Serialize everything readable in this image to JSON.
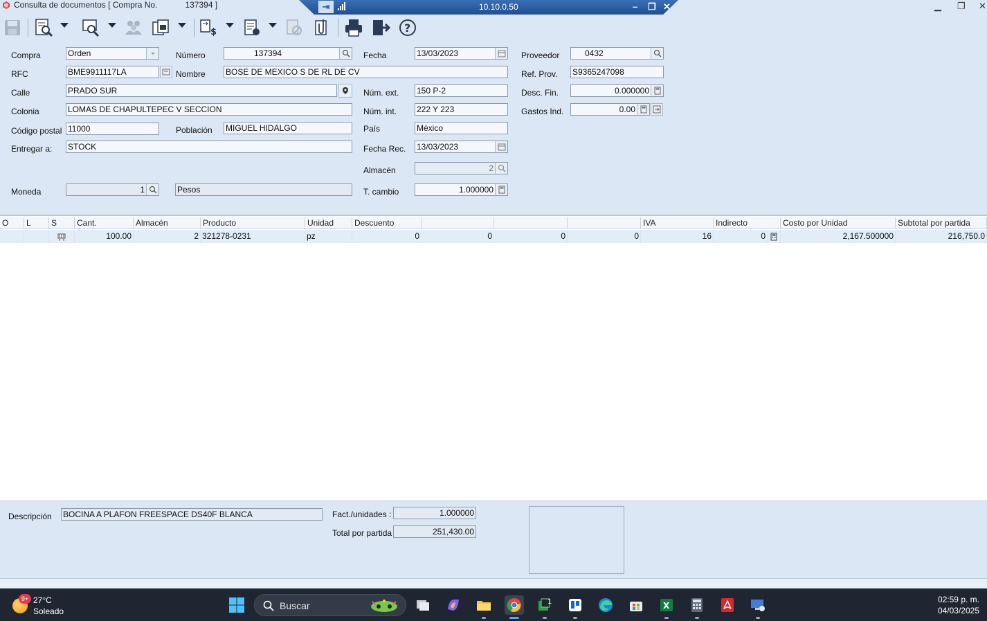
{
  "window": {
    "title": "Consulta de documentos [ Compra No.",
    "title_number": "137394 ]"
  },
  "rdp": {
    "host": "10.10.0.50"
  },
  "toolbar": {
    "icons": [
      "save-icon",
      "preview-icon",
      "search-document-icon",
      "users-icon",
      "copy-document-icon",
      "exchange-icon",
      "document-list-icon",
      "cancel-document-icon",
      "attach-icon",
      "print-icon",
      "exit-icon",
      "help-icon"
    ]
  },
  "form": {
    "compra": {
      "label": "Compra",
      "value": "Orden"
    },
    "numero": {
      "label": "Número",
      "value": "137394"
    },
    "fecha": {
      "label": "Fecha",
      "value": "13/03/2023"
    },
    "proveedor": {
      "label": "Proveedor",
      "value": "0432"
    },
    "rfc": {
      "label": "RFC",
      "value": "BME9911117LA"
    },
    "nombre": {
      "label": "Nombre",
      "value": "BOSE DE MEXICO S DE RL DE CV"
    },
    "ref_prov": {
      "label": "Ref. Prov.",
      "value": "S9365247098"
    },
    "calle": {
      "label": "Calle",
      "value": "PRADO SUR"
    },
    "num_ext": {
      "label": "Núm. ext.",
      "value": "150 P-2"
    },
    "desc_fin": {
      "label": "Desc. Fin.",
      "value": "0.000000"
    },
    "colonia": {
      "label": "Colonia",
      "value": "LOMAS DE CHAPULTEPEC V SECCION"
    },
    "num_int": {
      "label": "Núm. int.",
      "value": "222 Y 223"
    },
    "gastos_ind": {
      "label": "Gastos Ind.",
      "value": "0.00"
    },
    "codigo_postal": {
      "label": "Código postal",
      "value": "11000"
    },
    "poblacion": {
      "label": "Población",
      "value": "MIGUEL HIDALGO"
    },
    "pais": {
      "label": "País",
      "value": "México"
    },
    "entregar": {
      "label": "Entregar a:",
      "value": "STOCK"
    },
    "fecha_rec": {
      "label": "Fecha Rec.",
      "value": "13/03/2023"
    },
    "almacen": {
      "label": "Almacén",
      "value": "2"
    },
    "moneda": {
      "label": "Moneda",
      "value": "1",
      "name": "Pesos"
    },
    "t_cambio": {
      "label": "T. cambio",
      "value": "1.000000"
    }
  },
  "grid": {
    "columns": [
      "O",
      "L",
      "S",
      "Cant.",
      "Almacén",
      "Producto",
      "Unidad",
      "Descuento",
      "",
      "",
      "",
      "IVA",
      "Indirecto",
      "Costo por Unidad",
      "Subtotal por partida"
    ],
    "rows": [
      {
        "cant": "100.00",
        "almacen": "2",
        "producto": "321278-0231",
        "unidad": "pz",
        "descuento": "0",
        "c8": "0",
        "c9": "0",
        "c10": "0",
        "iva": "16",
        "indirecto": "0",
        "costo": "2,167.500000",
        "subtotal": "216,750.0"
      }
    ]
  },
  "bottom": {
    "descripcion": {
      "label": "Descripción",
      "value": "BOCINA A PLAFON FREESPACE DS40F BLANCA"
    },
    "fact_unidades": {
      "label": "Fact./unidades :",
      "value": "1.000000"
    },
    "total_partida": {
      "label": "Total por partida",
      "value": "251,430.00"
    }
  },
  "taskbar": {
    "weather": {
      "badge": "9+",
      "temp": "27°C",
      "condition": "Soleado"
    },
    "search_placeholder": "Buscar",
    "clock": {
      "time": "02:59 p. m.",
      "date": "04/03/2025"
    },
    "apps": [
      "task-view-icon",
      "copilot-icon",
      "file-explorer-icon",
      "chrome-icon",
      "remote-app-icon",
      "trello-icon",
      "edge-icon",
      "store-icon",
      "excel-icon",
      "calculator-icon",
      "acrobat-icon",
      "remote-desktop-icon"
    ],
    "remote_app_badge": "1"
  }
}
